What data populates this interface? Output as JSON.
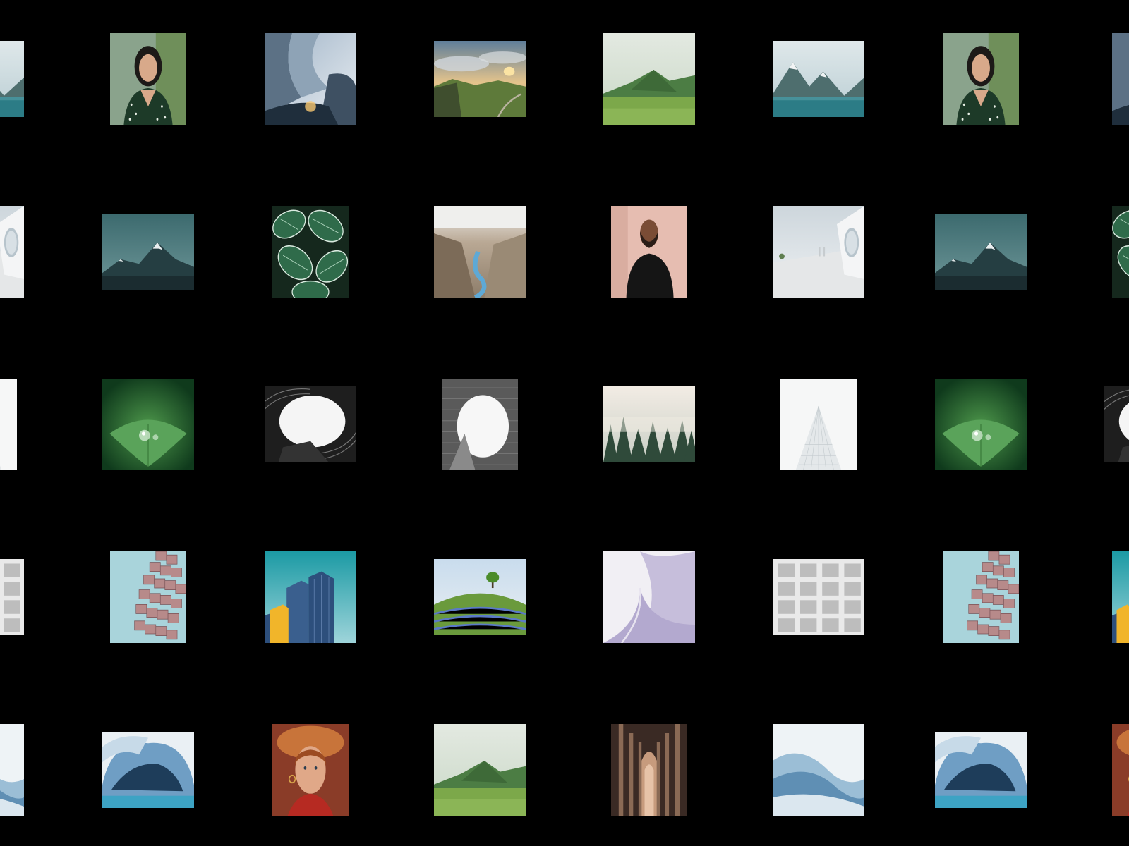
{
  "background": "#000000",
  "gallery": {
    "rows": [
      [
        "mountain-lake",
        "woman-portrait",
        "curved-metal-building",
        "cloudy-cliff",
        "green-hills",
        "mountain-lake",
        "woman-portrait",
        "curved-metal-building"
      ],
      [
        "white-arch-walkway",
        "teal-mountain-peak",
        "striped-leaves",
        "canyon-river",
        "man-portrait",
        "white-arch-walkway",
        "teal-mountain-peak",
        "striped-leaves"
      ],
      [
        "foggy-skyscraper",
        "water-drop-leaf",
        "circular-building-sky",
        "round-opening-sky",
        "misty-forest",
        "foggy-skyscraper",
        "water-drop-leaf",
        "circular-building-sky"
      ],
      [
        "white-facade",
        "pink-block-tower",
        "yellow-blue-buildings",
        "tree-on-hill",
        "lavender-curved-roof",
        "white-facade",
        "pink-block-tower",
        "yellow-blue-buildings"
      ],
      [
        "misty-blue-mountains",
        "ice-cave",
        "woman-in-hat",
        "green-hills",
        "cathedral-arches",
        "misty-blue-mountains",
        "ice-cave",
        "woman-in-hat"
      ]
    ]
  }
}
